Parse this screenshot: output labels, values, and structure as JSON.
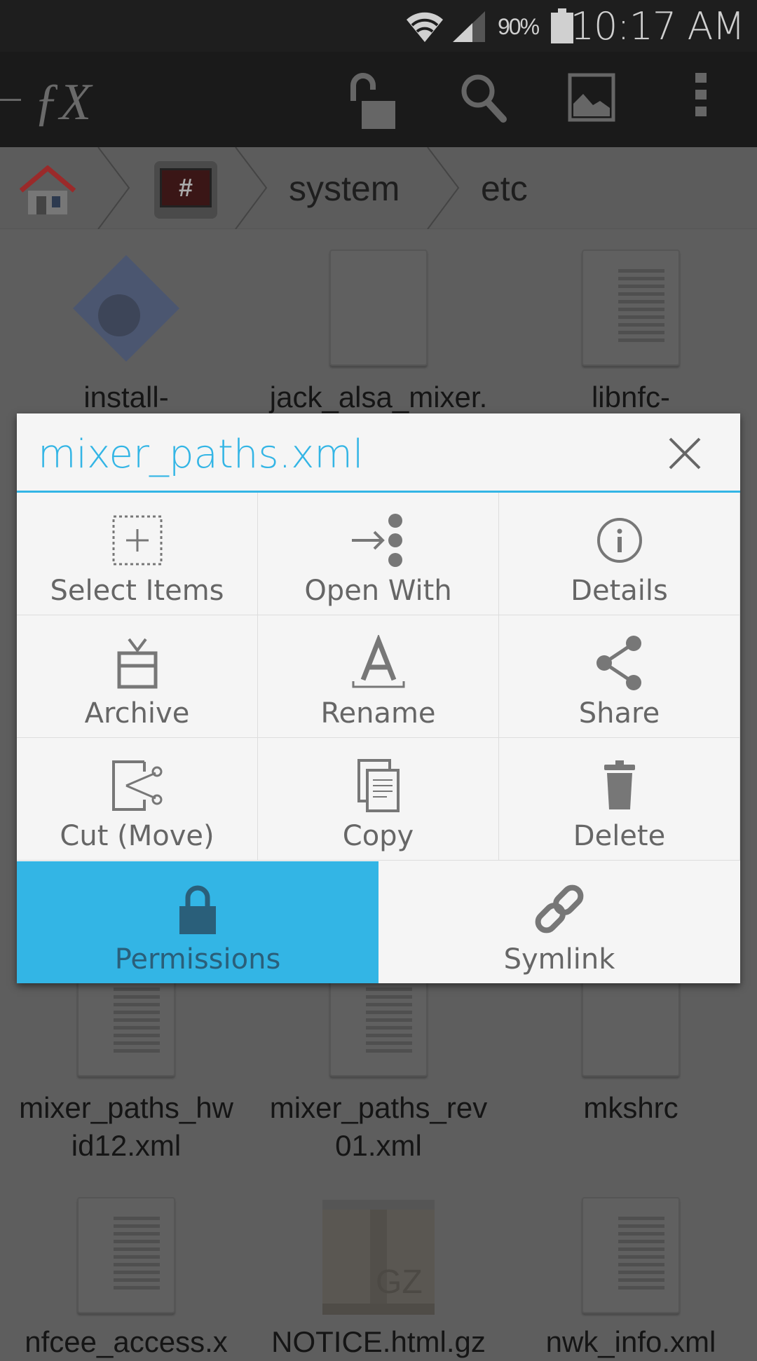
{
  "status_bar": {
    "battery": "90%",
    "time": "10:17 AM",
    "icons": [
      "wifi-icon",
      "signal-icon",
      "battery-icon"
    ]
  },
  "toolbar": {
    "logo": "FX",
    "icons": [
      "unlock-icon",
      "search-icon",
      "image-icon",
      "overflow-menu-icon"
    ]
  },
  "breadcrumb": {
    "items": [
      "home",
      "root",
      "system",
      "etc"
    ],
    "labels": {
      "system": "system",
      "etc": "etc"
    }
  },
  "files": [
    {
      "name": "install-"
    },
    {
      "name": "jack_alsa_mixer."
    },
    {
      "name": "libnfc-"
    },
    {
      "name": "mixer_paths_hw",
      "name2": "id12.xml"
    },
    {
      "name": "mixer_paths_rev",
      "name2": "01.xml"
    },
    {
      "name": "mkshrc"
    },
    {
      "name": "nfcee_access.x"
    },
    {
      "name": "NOTICE.html.gz",
      "badge": "GZ"
    },
    {
      "name": "nwk_info.xml"
    }
  ],
  "dialog": {
    "title": "mixer_paths.xml",
    "options": [
      {
        "label": "Select Items",
        "icon": "select-items-icon"
      },
      {
        "label": "Open With",
        "icon": "open-with-icon"
      },
      {
        "label": "Details",
        "icon": "info-icon"
      },
      {
        "label": "Archive",
        "icon": "archive-icon"
      },
      {
        "label": "Rename",
        "icon": "rename-icon"
      },
      {
        "label": "Share",
        "icon": "share-icon"
      },
      {
        "label": "Cut (Move)",
        "icon": "cut-icon"
      },
      {
        "label": "Copy",
        "icon": "copy-icon"
      },
      {
        "label": "Delete",
        "icon": "trash-icon"
      },
      {
        "label": "Permissions",
        "icon": "lock-icon",
        "selected": true
      },
      {
        "label": "Symlink",
        "icon": "link-icon"
      }
    ],
    "accent": "#33b5e5"
  }
}
